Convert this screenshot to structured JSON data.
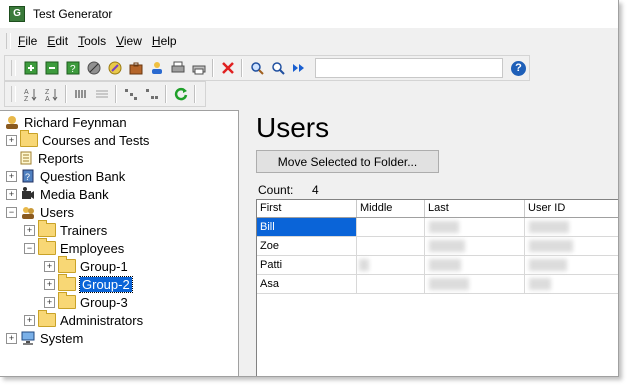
{
  "window": {
    "title": "Test Generator"
  },
  "menu": [
    {
      "key": "F",
      "rest": "ile"
    },
    {
      "key": "E",
      "rest": "dit"
    },
    {
      "key": "T",
      "rest": "ools"
    },
    {
      "key": "V",
      "rest": "iew"
    },
    {
      "key": "H",
      "rest": "elp"
    }
  ],
  "toolbar": {
    "search_value": "",
    "help_label": "?"
  },
  "tree": {
    "root": "Richard Feynman",
    "courses": "Courses and Tests",
    "reports": "Reports",
    "question_bank": "Question Bank",
    "media_bank": "Media Bank",
    "users": "Users",
    "trainers": "Trainers",
    "employees": "Employees",
    "group1": "Group-1",
    "group2": "Group-2",
    "group3": "Group-3",
    "administrators": "Administrators",
    "system": "System"
  },
  "main": {
    "title": "Users",
    "move_button": "Move Selected to Folder...",
    "count_label": "Count:",
    "count_value": "4"
  },
  "grid": {
    "headers": {
      "first": "First",
      "middle": "Middle",
      "last": "Last",
      "user_id": "User ID"
    },
    "rows": [
      {
        "first": "Bill"
      },
      {
        "first": "Zoe"
      },
      {
        "first": "Patti"
      },
      {
        "first": "Asa"
      }
    ]
  },
  "colors": {
    "selection": "#0a64d8",
    "folder": "#f8d775"
  }
}
